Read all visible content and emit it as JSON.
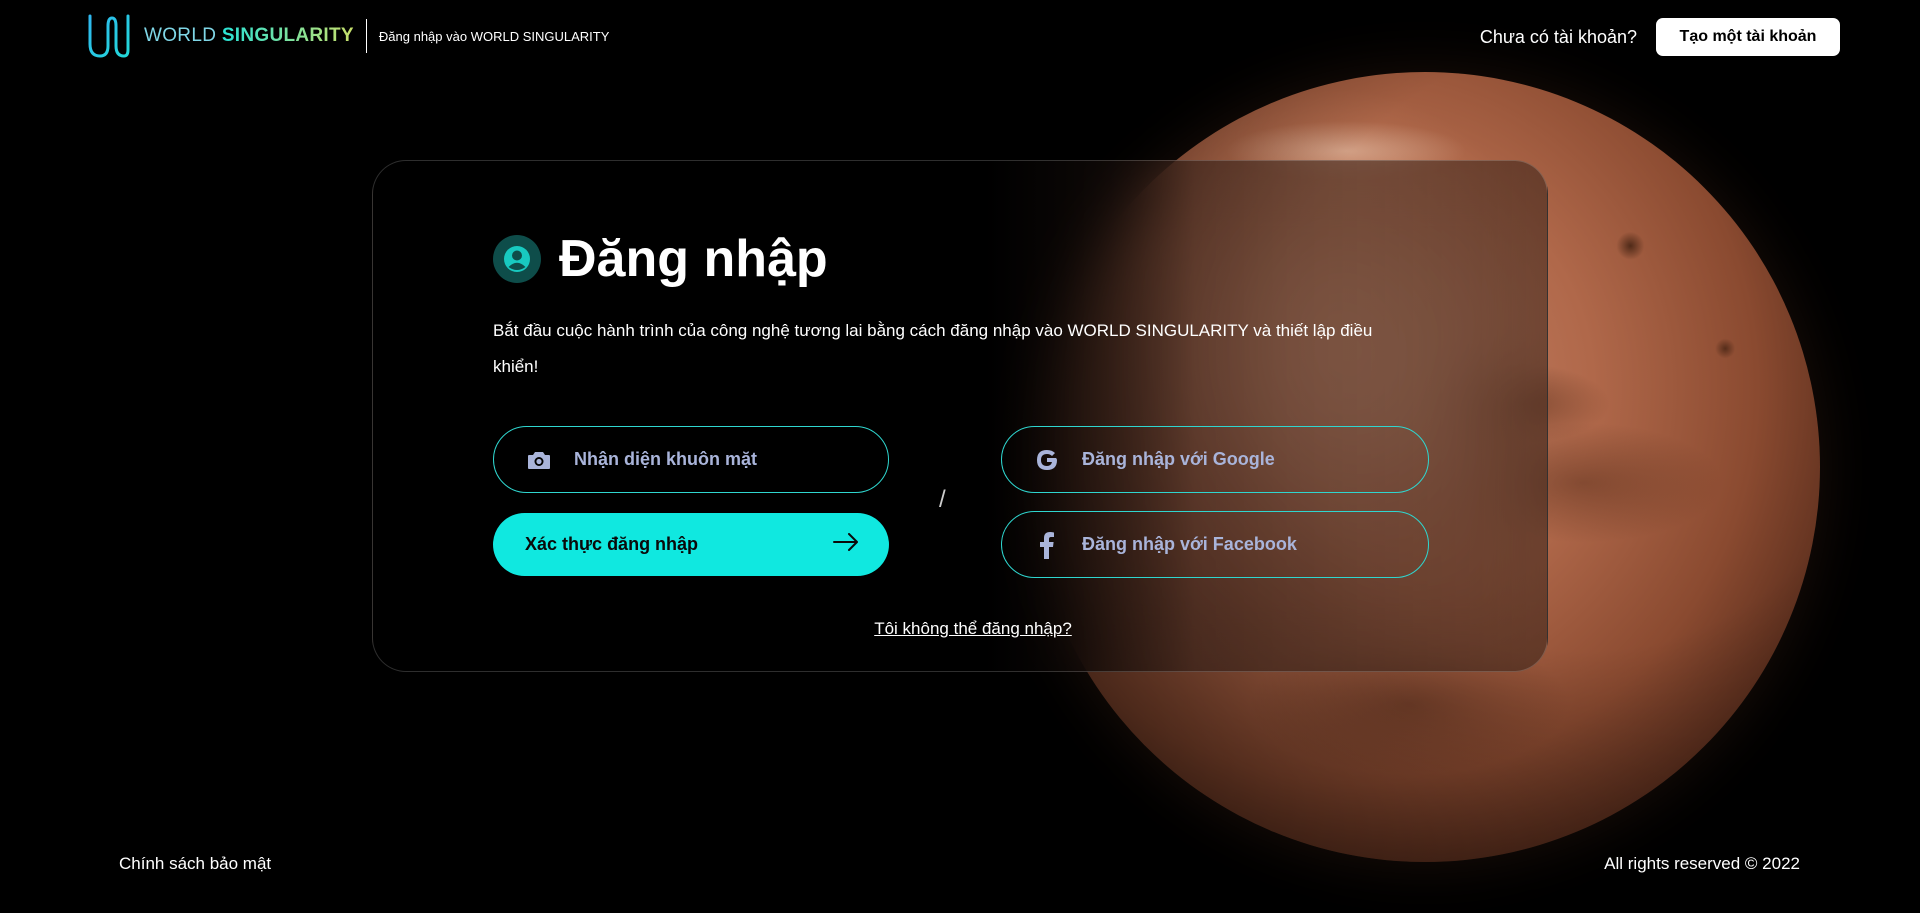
{
  "header": {
    "brand_light": "WORLD ",
    "brand_bold": "SINGULARITY",
    "subtitle": "Đăng nhập vào WORLD SINGULARITY",
    "no_account": "Chưa có tài khoản?",
    "create_account": "Tạo một tài khoản"
  },
  "card": {
    "title": "Đăng nhập",
    "description": "Bắt đầu cuộc hành trình của công nghệ tương lai bằng cách đăng nhập vào WORLD SINGULARITY và thiết lập điều khiển!",
    "face_login": "Nhận diện khuôn mặt",
    "verify_login": "Xác thực đăng nhập",
    "separator": "/",
    "google_login": "Đăng nhập với Google",
    "facebook_login": "Đăng nhập với Facebook",
    "cant_login": "Tôi không thể đăng nhập?"
  },
  "footer": {
    "privacy": "Chính sách bảo mật",
    "copyright": "All rights reserved © 2022"
  },
  "icons": {
    "logo": "w-logo-icon",
    "title": "user-circle-icon",
    "face": "camera-icon",
    "verify": "arrow-right-icon",
    "google": "google-icon",
    "facebook": "facebook-icon"
  },
  "colors": {
    "accent": "#10e8e0",
    "outline": "#2fd6cf",
    "button_text": "#a9b4da",
    "background": "#000000"
  }
}
